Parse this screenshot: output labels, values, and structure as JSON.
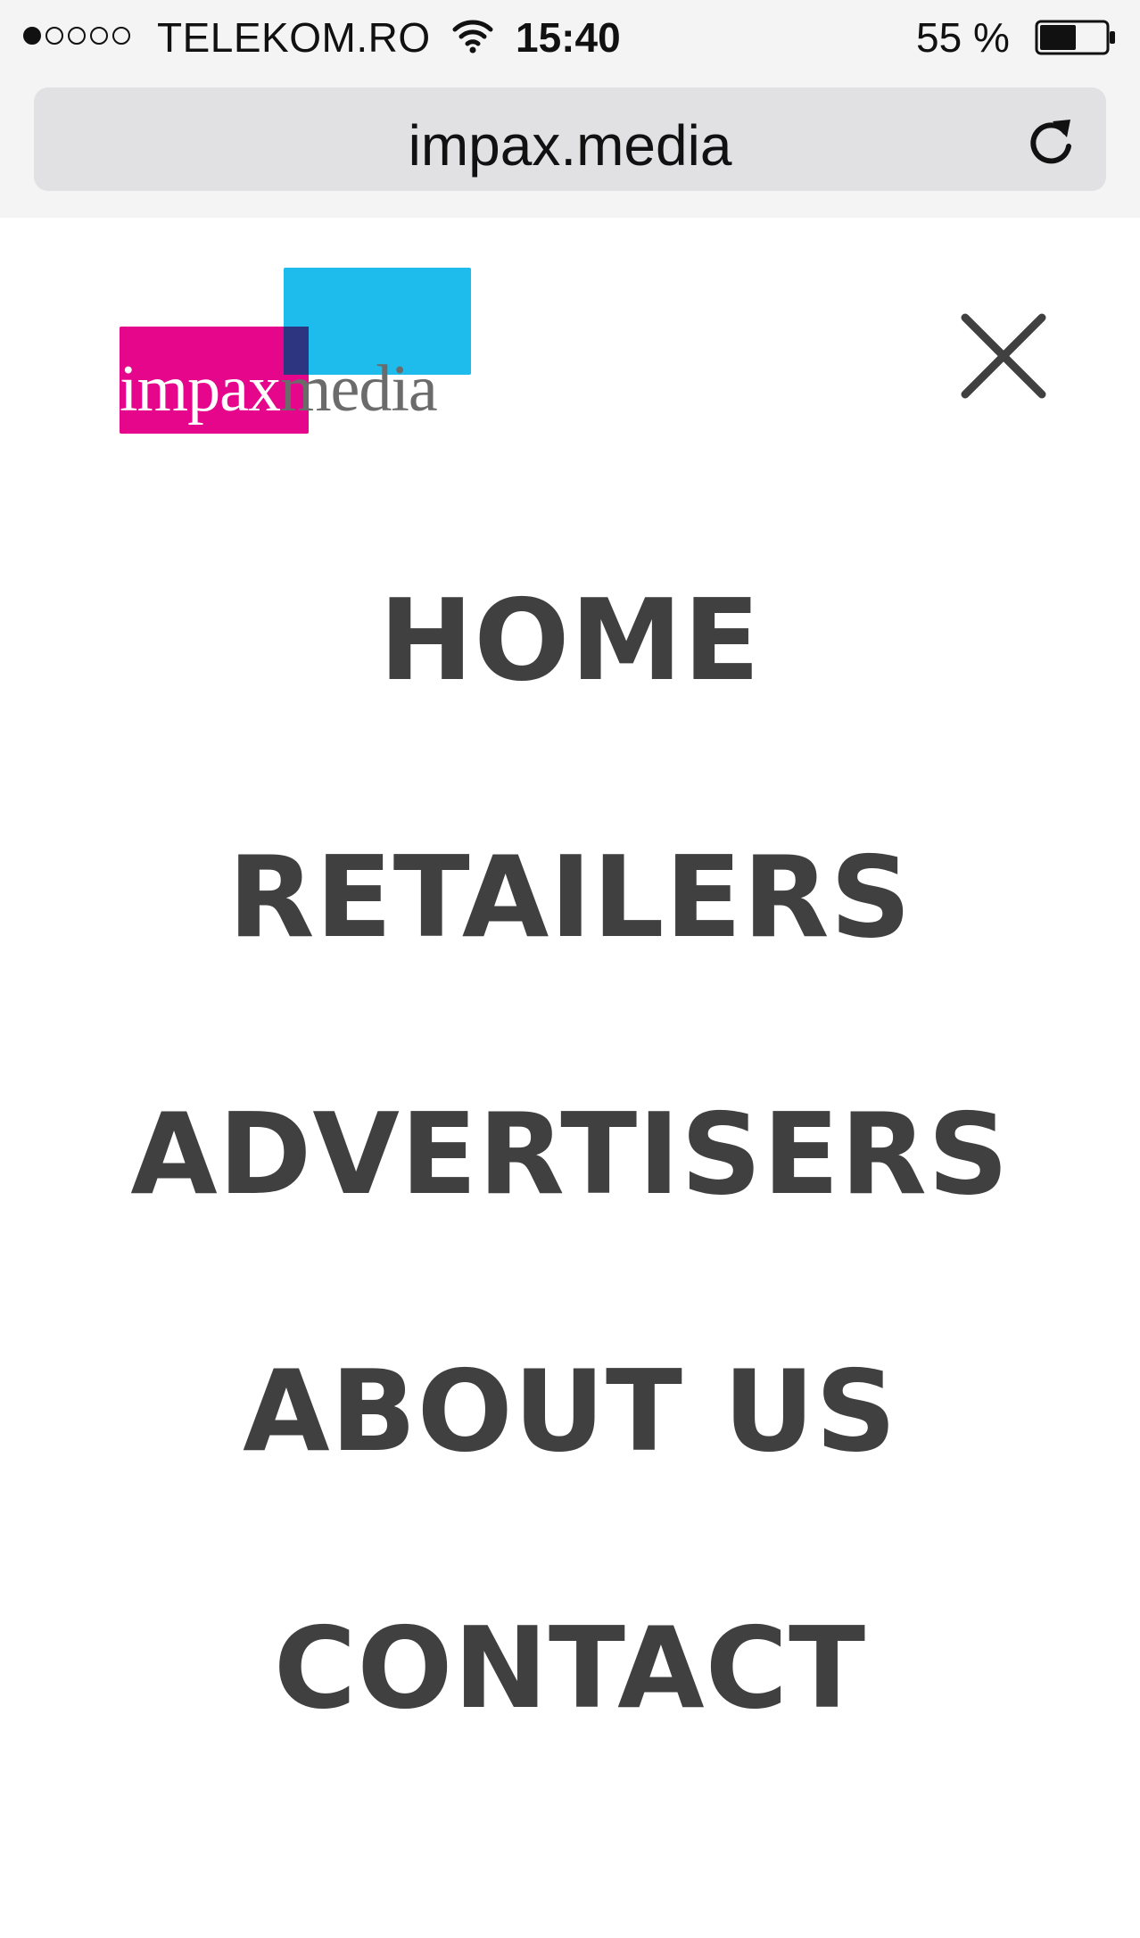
{
  "status_bar": {
    "signal_bars_filled": 1,
    "signal_bars_total": 5,
    "carrier": "TELEKOM.RO",
    "wifi_icon": "wifi-icon",
    "time": "15:40",
    "battery_percent": "55 %",
    "battery_level": 0.55,
    "battery_icon": "battery-icon"
  },
  "browser": {
    "url": "impax.media",
    "reload_icon": "reload-icon"
  },
  "header": {
    "logo_text_part1": "impax",
    "logo_text_part2": "media",
    "logo_colors": {
      "pink": "#e5068c",
      "blue": "#1ebcec"
    },
    "close_icon": "close-icon"
  },
  "menu": {
    "items": [
      {
        "label": "HOME"
      },
      {
        "label": "RETAILERS"
      },
      {
        "label": "ADVERTISERS"
      },
      {
        "label": "ABOUT US"
      },
      {
        "label": "CONTACT"
      }
    ],
    "text_color": "#404040"
  }
}
